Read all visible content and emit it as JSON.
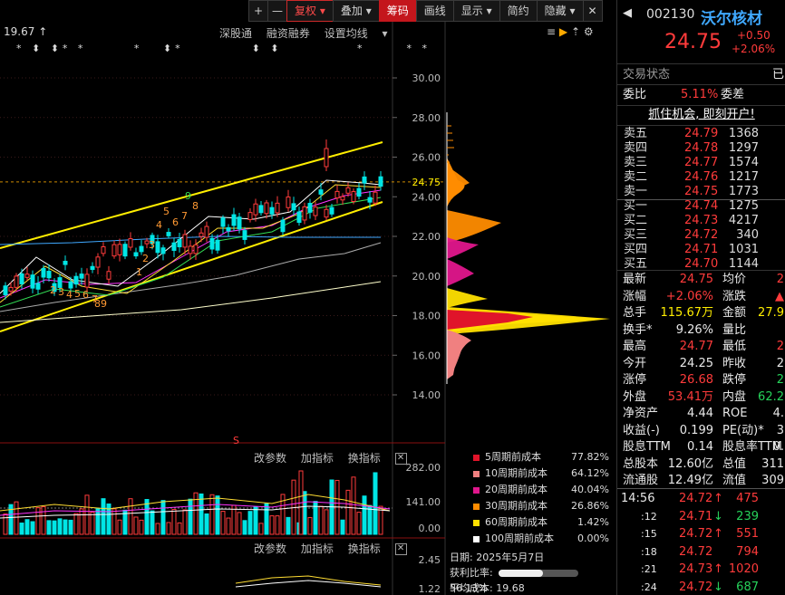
{
  "toolbar": {
    "plus": "+",
    "minus": "—",
    "fuquan": "复权",
    "diejia": "叠加",
    "chouma": "筹码",
    "huaxian": "画线",
    "xianshi": "显示",
    "jianyue": "简约",
    "yincang": "隐藏",
    "nav": "◀▶",
    "close": "✕"
  },
  "chart": {
    "top_value": "19.67",
    "links": [
      "深股通",
      "融资融券",
      "设置均线"
    ],
    "y_axis": [
      "30.00",
      "28.00",
      "26.00",
      "24.75",
      "24.00",
      "22.00",
      "20.00",
      "18.00",
      "16.00",
      "14.00"
    ],
    "price_tag": "24.75",
    "seq_numbers": [
      "2",
      "3",
      "4",
      "5",
      "6",
      "7",
      "8",
      "9",
      "1",
      "2",
      "3",
      "4",
      "5",
      "6",
      "7",
      "8",
      "9"
    ],
    "vol_axis": [
      "282.00",
      "141.00",
      "0.00"
    ],
    "macd_axis": [
      "2.45",
      "1.22"
    ],
    "indicator_menu": [
      "改参数",
      "加指标",
      "换指标"
    ],
    "s_mark": "S"
  },
  "legend": [
    {
      "label": "5周期前成本",
      "pct": "77.82%",
      "color": "#e0142a"
    },
    {
      "label": "10周期前成本",
      "pct": "64.12%",
      "color": "#f08080"
    },
    {
      "label": "20周期前成本",
      "pct": "40.04%",
      "color": "#e0168c"
    },
    {
      "label": "30周期前成本",
      "pct": "26.86%",
      "color": "#ff8c00"
    },
    {
      "label": "60周期前成本",
      "pct": "1.42%",
      "color": "#ffe000"
    },
    {
      "label": "100周期前成本",
      "pct": "0.00%",
      "color": "#ffffff"
    }
  ],
  "chip_info": {
    "date": "日期: 2025年5月7日",
    "profit_label": "获利比率:",
    "profit_pct": "56.13%",
    "profit_value": 0.5613,
    "avg_cost": "平均成本: 19.68"
  },
  "stock": {
    "code": "002130",
    "name": "沃尔核材",
    "price": "24.75",
    "change": "+0.50",
    "change_pct": "+2.06%",
    "status_label": "交易状态",
    "status_val": "已",
    "weibi_label": "委比",
    "weibi_val": "5.11%",
    "weicha_label": "委差",
    "promo": "抓住机会, 即刻开户!"
  },
  "orderbook": {
    "sells": [
      {
        "label": "卖五",
        "price": "24.79",
        "vol": "1368"
      },
      {
        "label": "卖四",
        "price": "24.78",
        "vol": "1297"
      },
      {
        "label": "卖三",
        "price": "24.77",
        "vol": "1574"
      },
      {
        "label": "卖二",
        "price": "24.76",
        "vol": "1217"
      },
      {
        "label": "卖一",
        "price": "24.75",
        "vol": "1773"
      }
    ],
    "buys": [
      {
        "label": "买一",
        "price": "24.74",
        "vol": "1275"
      },
      {
        "label": "买二",
        "price": "24.73",
        "vol": "4217"
      },
      {
        "label": "买三",
        "price": "24.72",
        "vol": "340"
      },
      {
        "label": "买四",
        "price": "24.71",
        "vol": "1031"
      },
      {
        "label": "买五",
        "price": "24.70",
        "vol": "1144"
      }
    ]
  },
  "quotes": [
    {
      "l1": "最新",
      "v1": "24.75",
      "c1": "red",
      "l2": "均价",
      "v2": "2",
      "c2": "red"
    },
    {
      "l1": "涨幅",
      "v1": "+2.06%",
      "c1": "red",
      "l2": "涨跌",
      "v2": "▲",
      "c2": "red"
    },
    {
      "l1": "总手",
      "v1": "115.67万",
      "c1": "yellow",
      "l2": "金额",
      "v2": "27.9",
      "c2": "yellow"
    },
    {
      "l1": "换手*",
      "v1": "9.26%",
      "c1": "white",
      "l2": "量比",
      "v2": "",
      "c2": "white"
    },
    {
      "l1": "最高",
      "v1": "24.77",
      "c1": "red",
      "l2": "最低",
      "v2": "2",
      "c2": "red"
    },
    {
      "l1": "今开",
      "v1": "24.25",
      "c1": "white",
      "l2": "昨收",
      "v2": "2",
      "c2": "white"
    },
    {
      "l1": "涨停",
      "v1": "26.68",
      "c1": "red",
      "l2": "跌停",
      "v2": "2",
      "c2": "green"
    },
    {
      "l1": "外盘",
      "v1": "53.41万",
      "c1": "red",
      "l2": "内盘",
      "v2": "62.2",
      "c2": "green"
    },
    {
      "l1": "净资产",
      "v1": "4.44",
      "c1": "white",
      "l2": "ROE",
      "v2": "4.",
      "c2": "white"
    },
    {
      "l1": "收益(-)",
      "v1": "0.199",
      "c1": "white",
      "l2": "PE(动)*",
      "v2": "3",
      "c2": "white"
    },
    {
      "l1": "股息TTM",
      "v1": "0.14",
      "c1": "white",
      "l2": "股息率TTM",
      "v2": "0.",
      "c2": "white"
    },
    {
      "l1": "总股本",
      "v1": "12.60亿",
      "c1": "white",
      "l2": "总值",
      "v2": "311",
      "c2": "white"
    },
    {
      "l1": "流通股",
      "v1": "12.49亿",
      "c1": "white",
      "l2": "流值",
      "v2": "309",
      "c2": "white"
    }
  ],
  "ticks": [
    {
      "time": "14:56",
      "price": "24.72",
      "dir": "↑",
      "vol": "475",
      "dc": "red"
    },
    {
      "time": ":12",
      "price": "24.71",
      "dir": "↓",
      "vol": "239",
      "dc": "green"
    },
    {
      "time": ":15",
      "price": "24.72",
      "dir": "↑",
      "vol": "551",
      "dc": "red"
    },
    {
      "time": ":18",
      "price": "24.72",
      "dir": "",
      "vol": "794",
      "dc": "red"
    },
    {
      "time": ":21",
      "price": "24.73",
      "dir": "↑",
      "vol": "1020",
      "dc": "red"
    },
    {
      "time": ":24",
      "price": "24.72",
      "dir": "↓",
      "vol": "687",
      "dc": "green"
    }
  ]
}
